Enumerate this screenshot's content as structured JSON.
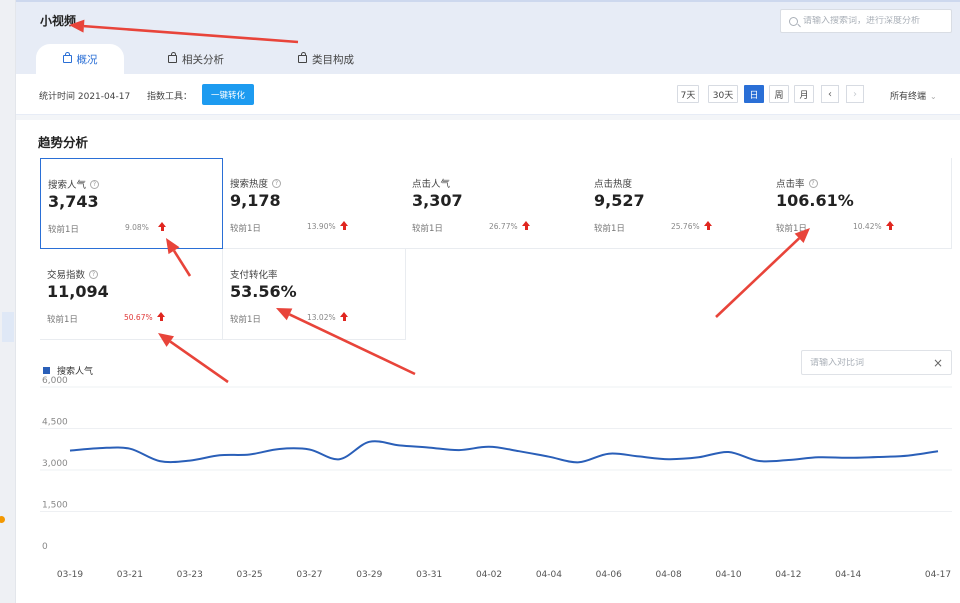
{
  "page": {
    "title": "小视频"
  },
  "search": {
    "placeholder": "请输入搜索词，进行深度分析"
  },
  "tabs": [
    {
      "label": "概况",
      "active": true
    },
    {
      "label": "相关分析",
      "active": false
    },
    {
      "label": "类目构成",
      "active": false
    }
  ],
  "stat_bar": {
    "date_text": "统计时间 2021-04-17",
    "tool_label": "指数工具：",
    "convert_label": "一键转化",
    "periods": [
      "7天",
      "30天",
      "日",
      "周",
      "月"
    ],
    "active_period": "日",
    "prev": "‹",
    "next": "›",
    "terminal_label": "所有终端",
    "terminal_chev": "⌄"
  },
  "section": {
    "title": "趋势分析"
  },
  "cards": [
    {
      "label": "搜索人气",
      "help": true,
      "value": "3,743",
      "compare": "较前1日",
      "change": "9.08%",
      "change_color": "gray",
      "selected": true
    },
    {
      "label": "搜索热度",
      "help": true,
      "value": "9,178",
      "compare": "较前1日",
      "change": "13.90%",
      "change_color": "gray",
      "selected": false
    },
    {
      "label": "点击人气",
      "help": false,
      "value": "3,307",
      "compare": "较前1日",
      "change": "26.77%",
      "change_color": "gray",
      "selected": false
    },
    {
      "label": "点击热度",
      "help": false,
      "value": "9,527",
      "compare": "较前1日",
      "change": "25.76%",
      "change_color": "gray",
      "selected": false
    },
    {
      "label": "点击率",
      "help": true,
      "value": "106.61%",
      "compare": "较前1日",
      "change": "10.42%",
      "change_color": "gray",
      "selected": false
    },
    {
      "label": "交易指数",
      "help": true,
      "value": "11,094",
      "compare": "较前1日",
      "change": "50.67%",
      "change_color": "red",
      "selected": false
    },
    {
      "label": "支付转化率",
      "help": false,
      "value": "53.56%",
      "compare": "较前1日",
      "change": "13.02%",
      "change_color": "gray",
      "selected": false
    }
  ],
  "compare_input": {
    "placeholder": "请输入对比词",
    "clear": "×"
  },
  "colors": {
    "accent": "#2a6fd6",
    "line": "#2a5fb8",
    "arrow": "#e8443a",
    "up": "#e0261f",
    "button": "#1d9bf0"
  },
  "chart_data": {
    "type": "line",
    "ylim": [
      0,
      6000
    ],
    "y_ticks": [
      0,
      1500,
      3000,
      4500,
      6000
    ],
    "y_tick_labels": [
      "0",
      "1,500",
      "3,000",
      "4,500",
      "6,000"
    ],
    "x": [
      "03-19",
      "03-20",
      "03-21",
      "03-22",
      "03-23",
      "03-24",
      "03-25",
      "03-26",
      "03-27",
      "03-28",
      "03-29",
      "03-30",
      "03-31",
      "04-01",
      "04-02",
      "04-03",
      "04-04",
      "04-05",
      "04-06",
      "04-07",
      "04-08",
      "04-09",
      "04-10",
      "04-11",
      "04-12",
      "04-13",
      "04-14",
      "04-15",
      "04-16",
      "04-17"
    ],
    "x_tick_labels": [
      "03-19",
      "03-21",
      "03-23",
      "03-25",
      "03-27",
      "03-29",
      "03-31",
      "04-02",
      "04-04",
      "04-06",
      "04-08",
      "04-10",
      "04-12",
      "04-14",
      "04-17"
    ],
    "series": [
      {
        "name": "搜索人气",
        "values": [
          3700,
          3790,
          3770,
          3320,
          3340,
          3530,
          3560,
          3760,
          3740,
          3390,
          4020,
          3890,
          3810,
          3720,
          3840,
          3680,
          3480,
          3280,
          3590,
          3490,
          3390,
          3460,
          3650,
          3330,
          3360,
          3460,
          3440,
          3470,
          3520,
          3680
        ]
      }
    ]
  }
}
